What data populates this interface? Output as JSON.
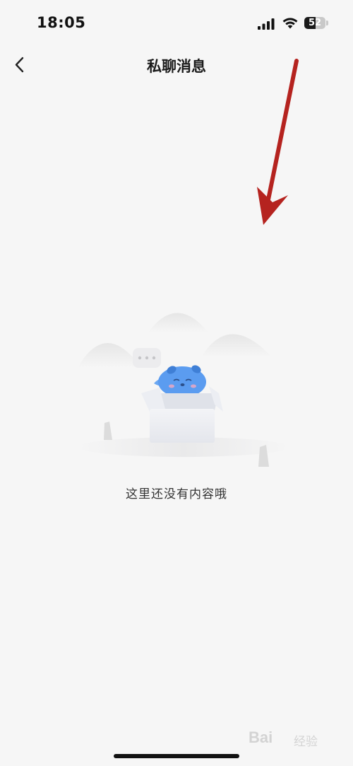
{
  "status_bar": {
    "time": "18:05",
    "battery_level": "52",
    "battery_fraction": 0.52,
    "icons": [
      "cellular-signal-icon",
      "wifi-icon",
      "battery-icon"
    ]
  },
  "nav": {
    "title": "私聊消息",
    "back_icon": "chevron-left-icon"
  },
  "empty_state": {
    "message": "这里还没有内容哦",
    "illustration": "empty-box-mascot-illustration"
  },
  "annotation": {
    "icon": "red-arrow-icon",
    "color": "#b5231f"
  },
  "watermark": {
    "brand": "Bai",
    "suffix": "经验"
  },
  "colors": {
    "background": "#f6f6f6",
    "title": "#1b1b1b",
    "text": "#333333",
    "mascot": "#5b9cf0"
  }
}
